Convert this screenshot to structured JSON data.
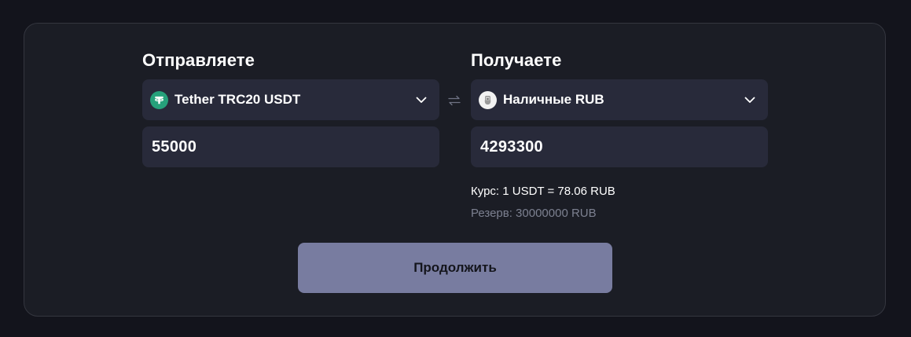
{
  "send": {
    "title": "Отправляете",
    "currency": {
      "label": "Tether TRC20 USDT",
      "icon": "tether-icon",
      "icon_color": "#26a17b"
    },
    "amount": "55000"
  },
  "receive": {
    "title": "Получаете",
    "currency": {
      "label": "Наличные RUB",
      "icon": "cash-icon"
    },
    "amount": "4293300"
  },
  "rate_text": "Курс: 1 USDT = 78.06 RUB",
  "reserve_text": "Резерв: 30000000 RUB",
  "continue_label": "Продолжить",
  "colors": {
    "background": "#13141c",
    "card": "#1b1d25",
    "field": "#282a3a",
    "button": "#787ca0",
    "muted_text": "#7c8090"
  }
}
